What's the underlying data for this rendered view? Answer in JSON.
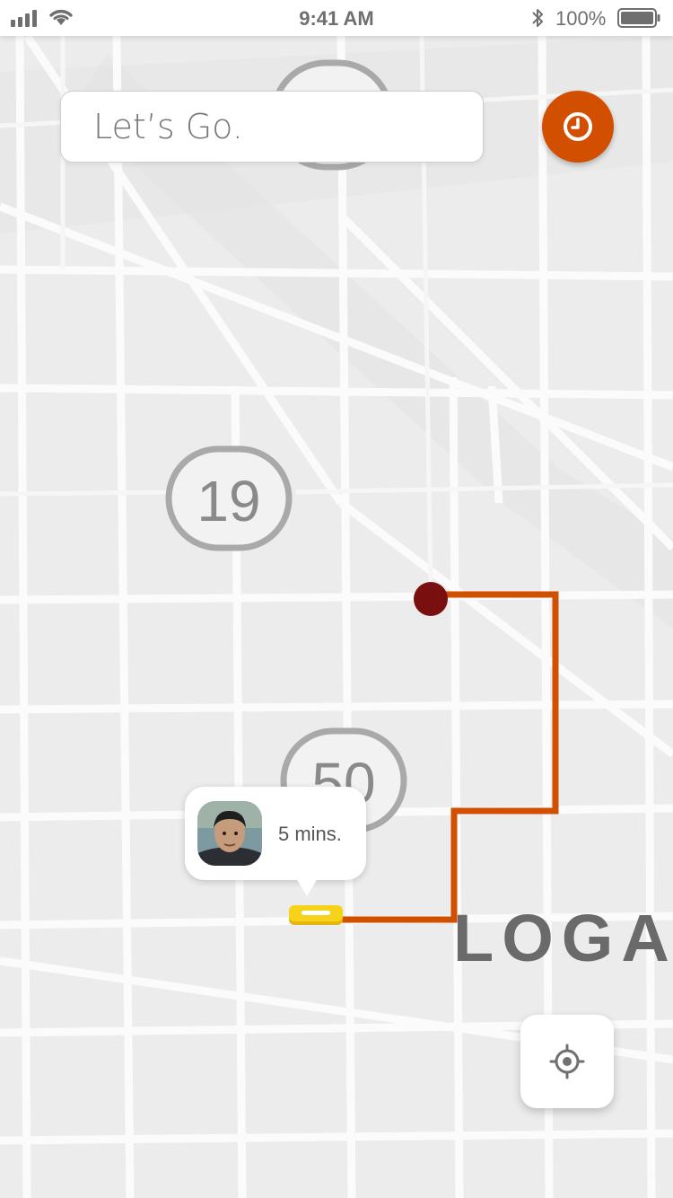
{
  "status_bar": {
    "time": "9:41 AM",
    "battery_percent": "100%",
    "icons": [
      "signal-icon",
      "wifi-icon",
      "bluetooth-icon",
      "battery-icon"
    ]
  },
  "search": {
    "placeholder": "Let’s Go."
  },
  "history_button": {
    "icon": "clock-icon"
  },
  "map": {
    "route_shields": [
      "19",
      "50"
    ],
    "district_label": "LOGAN",
    "colors": {
      "route": "#d05000",
      "destination": "#7a0f0f",
      "car": "#f6d31a"
    }
  },
  "eta_bubble": {
    "text": "5 mins."
  },
  "locate_button": {
    "icon": "crosshair-icon"
  }
}
